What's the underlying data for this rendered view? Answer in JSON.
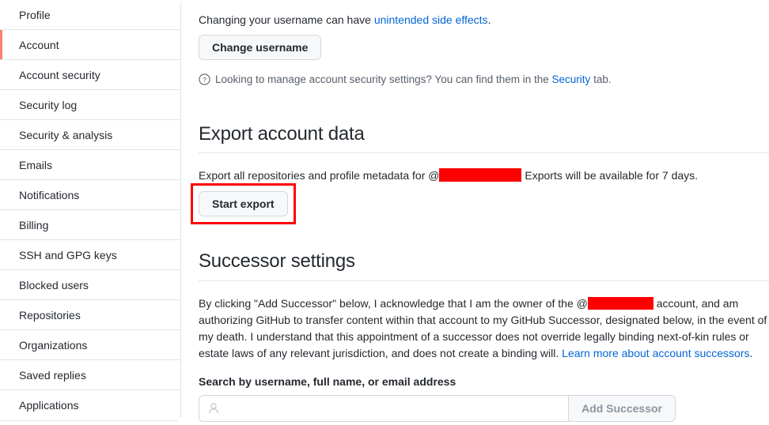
{
  "sidebar": {
    "items": [
      {
        "label": "Profile",
        "active": false
      },
      {
        "label": "Account",
        "active": true
      },
      {
        "label": "Account security",
        "active": false
      },
      {
        "label": "Security log",
        "active": false
      },
      {
        "label": "Security & analysis",
        "active": false
      },
      {
        "label": "Emails",
        "active": false
      },
      {
        "label": "Notifications",
        "active": false
      },
      {
        "label": "Billing",
        "active": false
      },
      {
        "label": "SSH and GPG keys",
        "active": false
      },
      {
        "label": "Blocked users",
        "active": false
      },
      {
        "label": "Repositories",
        "active": false
      },
      {
        "label": "Organizations",
        "active": false
      },
      {
        "label": "Saved replies",
        "active": false
      },
      {
        "label": "Applications",
        "active": false
      }
    ]
  },
  "username_section": {
    "warning_prefix": "Changing your username can have ",
    "warning_link": "unintended side effects",
    "warning_suffix": ".",
    "change_username_button": "Change username",
    "note_prefix": "Looking to manage account security settings? You can find them in the ",
    "note_link": "Security",
    "note_suffix": " tab.",
    "question_icon": "question-circle-icon"
  },
  "export_section": {
    "title": "Export account data",
    "description_prefix": "Export all repositories and profile metadata for @",
    "redacted_username": "",
    "description_suffix": " Exports will be available for 7 days.",
    "start_export_button": "Start export",
    "highlight_color": "#ff0000",
    "redaction_color": "#ff0000"
  },
  "successor_section": {
    "title": "Successor settings",
    "paragraph_part1": "By clicking \"Add Successor\" below, I acknowledge that I am the owner of the @",
    "redacted_username": "",
    "paragraph_part2": " account, and am authorizing GitHub to transfer content within that account to my GitHub Successor, designated below, in the event of my death. I understand that this appointment of a successor does not override legally binding next-of-kin rules or estate laws of any relevant jurisdiction, and does not create a binding will. ",
    "paragraph_link": "Learn more about account successors",
    "paragraph_part3": ".",
    "search_label": "Search by username, full name, or email address",
    "search_placeholder": "",
    "search_value": "",
    "search_icon": "person-icon",
    "add_successor_button": "Add Successor"
  },
  "colors": {
    "link": "#0366d6",
    "active_marker": "#f9826c",
    "border": "#e1e4e8",
    "button_bg": "#f6f8fa"
  }
}
